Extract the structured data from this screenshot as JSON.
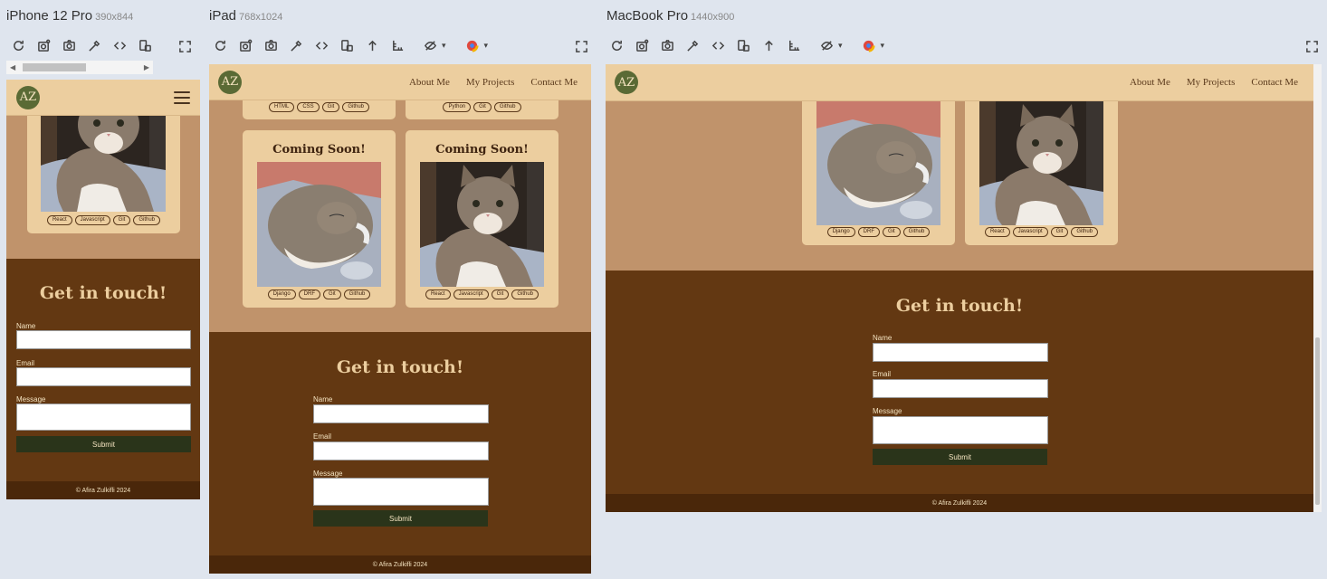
{
  "devices": [
    {
      "name": "iPhone 12 Pro",
      "dims": "390x844"
    },
    {
      "name": "iPad",
      "dims": "768x1024"
    },
    {
      "name": "MacBook Pro",
      "dims": "1440x900"
    }
  ],
  "site": {
    "logo": "AZ",
    "nav": [
      "About Me",
      "My Projects",
      "Contact Me"
    ],
    "projects": [
      {
        "title": "",
        "tags": [
          "HTML",
          "CSS",
          "Git",
          "Github"
        ]
      },
      {
        "title": "",
        "tags": [
          "Python",
          "Git",
          "Github"
        ]
      },
      {
        "title": "Coming Soon!",
        "tags": [
          "Django",
          "DRF",
          "Git",
          "Github"
        ]
      },
      {
        "title": "Coming Soon!",
        "tags": [
          "React",
          "Javascript",
          "Git",
          "Github"
        ]
      }
    ],
    "contact": {
      "title": "Get in touch!",
      "name_label": "Name",
      "email_label": "Email",
      "message_label": "Message",
      "submit": "Submit"
    },
    "footer": "© Afira Zulkifli 2024"
  },
  "icons": [
    "refresh-icon",
    "screenshot-settings-icon",
    "camera-icon",
    "eyedropper-icon",
    "code-icon",
    "rotate-icon",
    "arrow-up-icon",
    "ruler-icon",
    "eye-off-icon",
    "color-wheel-icon",
    "expand-icon"
  ],
  "colors": {
    "header": "#ecce9f",
    "section": "#c0936b",
    "contact": "#633812",
    "footer": "#4a270a",
    "button": "#2a341a",
    "logo": "#5a6a35"
  }
}
